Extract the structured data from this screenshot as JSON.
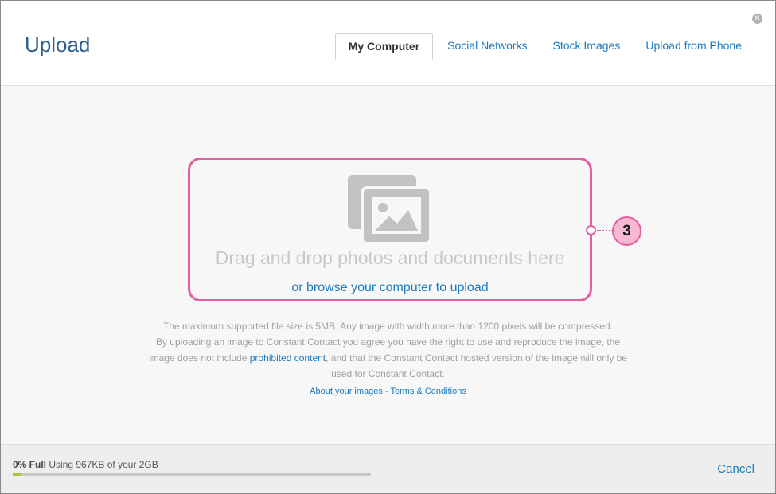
{
  "dialog": {
    "title": "Upload",
    "close_icon": "close-icon"
  },
  "tabs": [
    {
      "label": "My Computer",
      "active": true
    },
    {
      "label": "Social Networks",
      "active": false
    },
    {
      "label": "Stock Images",
      "active": false
    },
    {
      "label": "Upload from Phone",
      "active": false
    }
  ],
  "dropzone": {
    "icon": "photos-icon",
    "drop_text": "Drag and drop photos and documents here",
    "browse_link": "or browse your computer to upload"
  },
  "callout": {
    "number": "3"
  },
  "info": {
    "line1": "The maximum supported file size is 5MB. Any image with width more than 1200 pixels will be compressed.",
    "line2": "By uploading an image to Constant Contact you agree you have the right to use and reproduce the image, the",
    "line3_pre": "image does not include ",
    "line3_link": "prohibited content",
    "line3_post": ", and that the Constant Contact hosted version of the image will only be",
    "line4": "used for Constant Contact.",
    "about_link": "About your images",
    "separator": " - ",
    "terms_link": "Terms & Conditions"
  },
  "footer": {
    "usage_bold": "0% Full",
    "usage_text": " Using 967KB of your 2GB",
    "usage_fraction": 0.025,
    "cancel_label": "Cancel"
  },
  "colors": {
    "accent": "#1a7bbf",
    "highlight": "#e3609f",
    "progress": "#a4c639"
  }
}
